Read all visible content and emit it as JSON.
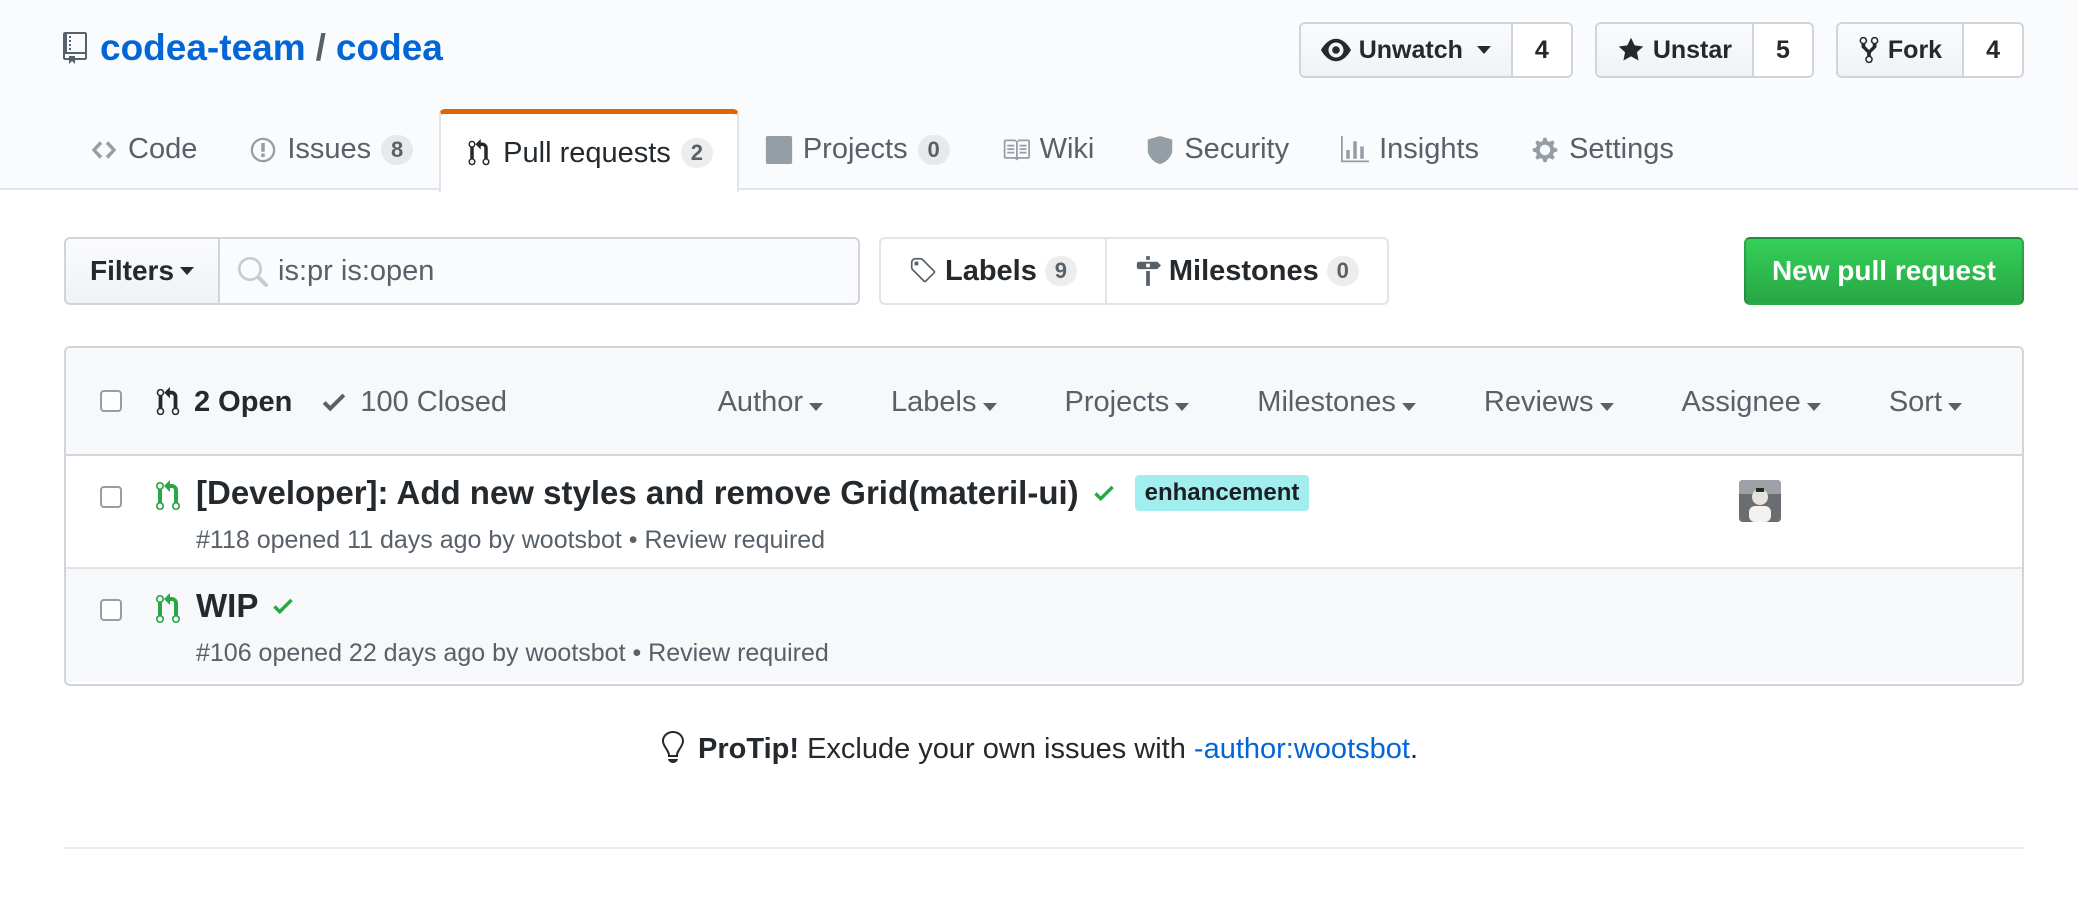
{
  "repo": {
    "owner": "codea-team",
    "separator": "/",
    "name": "codea"
  },
  "actions": [
    {
      "label": "Unwatch",
      "count": "4",
      "icon": "eye-icon"
    },
    {
      "label": "Unstar",
      "count": "5",
      "icon": "star-icon"
    },
    {
      "label": "Fork",
      "count": "4",
      "icon": "fork-icon"
    }
  ],
  "tabs": [
    {
      "label": "Code",
      "icon": "code-icon"
    },
    {
      "label": "Issues",
      "count": "8",
      "icon": "issue-icon"
    },
    {
      "label": "Pull requests",
      "count": "2",
      "icon": "pull-request-icon",
      "selected": true
    },
    {
      "label": "Projects",
      "count": "0",
      "icon": "project-icon"
    },
    {
      "label": "Wiki",
      "icon": "book-icon"
    },
    {
      "label": "Security",
      "icon": "shield-icon"
    },
    {
      "label": "Insights",
      "icon": "graph-icon"
    },
    {
      "label": "Settings",
      "icon": "gear-icon"
    }
  ],
  "subnav": {
    "filters_label": "Filters",
    "search_value": "is:pr is:open",
    "labels_label": "Labels",
    "labels_count": "9",
    "milestones_label": "Milestones",
    "milestones_count": "0",
    "new_pr_label": "New pull request"
  },
  "list_header": {
    "open_label": "2 Open",
    "closed_label": "100 Closed",
    "filters": [
      "Author",
      "Labels",
      "Projects",
      "Milestones",
      "Reviews",
      "Assignee",
      "Sort"
    ]
  },
  "pull_requests": [
    {
      "title": "[Developer]: Add new styles and remove Grid(materil-ui)",
      "status": "success",
      "label": "enhancement",
      "meta_prefix": "#118 opened 11 days ago by ",
      "author": "wootsbot",
      "review": " • Review required",
      "has_assignee": true
    },
    {
      "title": "WIP",
      "status": "success",
      "meta_prefix": "#106 opened 22 days ago by ",
      "author": "wootsbot",
      "review": " • Review required",
      "has_assignee": false
    }
  ],
  "protip": {
    "strong": "ProTip!",
    "text": " Exclude your own issues with ",
    "link": "-author:wootsbot",
    "end": "."
  },
  "colors": {
    "link": "#0366d6",
    "tab_accent": "#e36209",
    "success": "#28a745",
    "label_enhancement": "#a2eeef"
  }
}
